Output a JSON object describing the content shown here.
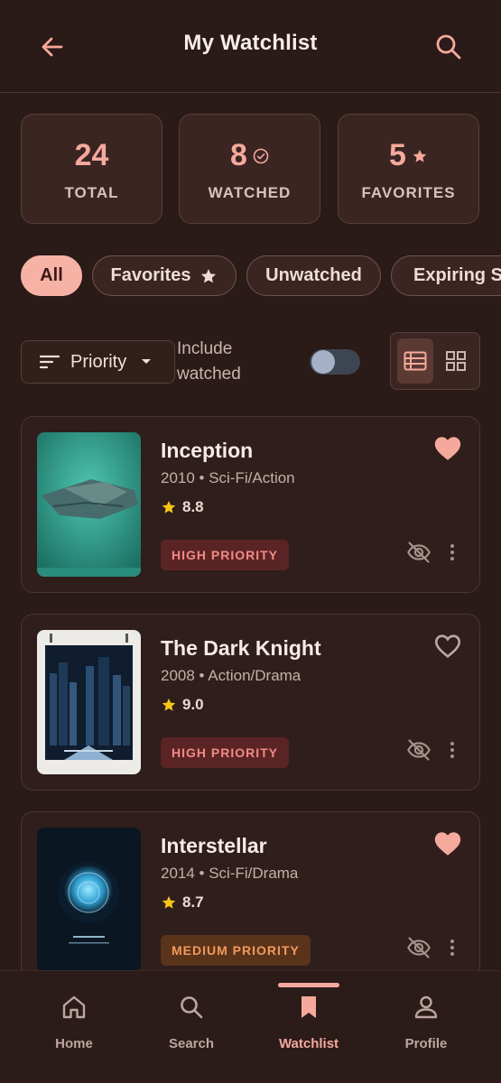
{
  "header": {
    "title": "My Watchlist",
    "back_icon": "arrow-left-icon",
    "search_icon": "search-icon"
  },
  "stats": [
    {
      "value": "24",
      "label": "TOTAL"
    },
    {
      "value": "8",
      "label": "WATCHED",
      "icon": "check-circle-icon"
    },
    {
      "value": "5",
      "label": "FAVORITES",
      "icon": "star-icon"
    }
  ],
  "filters": {
    "chips": [
      "All",
      "Favorites",
      "Unwatched",
      "Expiring So"
    ],
    "active": "All"
  },
  "controls": {
    "sort_label": "Priority",
    "include_label": "Include watched",
    "include_on": false
  },
  "movies": [
    {
      "title": "Inception",
      "meta": "2010 • Sci-Fi/Action",
      "rating": "8.8",
      "priority": "HIGH PRIORITY",
      "favorite": true
    },
    {
      "title": "The Dark Knight",
      "meta": "2008 • Action/Drama",
      "rating": "9.0",
      "priority": "HIGH PRIORITY",
      "favorite": false
    },
    {
      "title": "Interstellar",
      "meta": "2014 • Sci-Fi/Drama",
      "rating": "8.7",
      "priority": "MEDIUM PRIORITY",
      "favorite": true
    }
  ],
  "nav": {
    "items": [
      "Home",
      "Search",
      "Watchlist",
      "Profile"
    ],
    "active": "Watchlist"
  },
  "colors": {
    "background": "#2a1a18",
    "accent": "#f5a99c",
    "high_priority": "#f08a86",
    "medium_priority": "#f09a5c",
    "star": "#f5c518"
  }
}
